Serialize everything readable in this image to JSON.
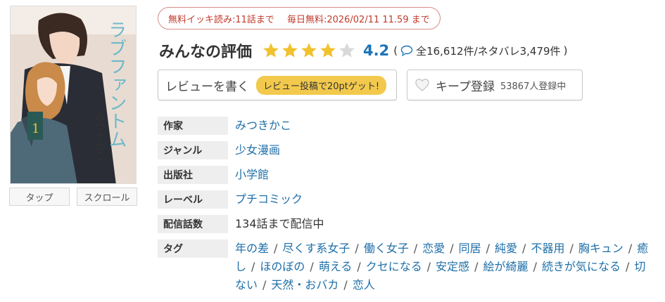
{
  "cover": {
    "title_vertical": "ラブファントム",
    "author_vertical": "みつきかこ",
    "volume": "1"
  },
  "viewer_buttons": [
    {
      "label": "タップ"
    },
    {
      "label": "スクロール"
    }
  ],
  "free_banner": {
    "text1": "無料イッキ読み:11話まで",
    "text2": "毎日無料:2026/02/11 11.59 まで"
  },
  "rating": {
    "title": "みんなの評価",
    "stars_filled": 4,
    "stars_total": 5,
    "score": "4.2",
    "count_text": "全16,612件/ネタバレ3,479件",
    "open_paren": "(",
    "close_paren": ")",
    "colors": {
      "star_filled": "#f2c12e",
      "star_empty": "#d9d9d9",
      "score": "#1a73b8"
    }
  },
  "review_button": {
    "label": "レビューを書く",
    "badge": "レビュー投稿で20ptゲット!"
  },
  "keep_button": {
    "label": "キープ登録",
    "count": "53867人登録中"
  },
  "info": {
    "author": {
      "label": "作家",
      "value": "みつきかこ"
    },
    "genre": {
      "label": "ジャンル",
      "value": "少女漫画"
    },
    "publisher": {
      "label": "出版社",
      "value": "小学館"
    },
    "label_row": {
      "label": "レーベル",
      "value": "プチコミック"
    },
    "episodes": {
      "label": "配信話数",
      "value": "134話まで配信中"
    },
    "tags": {
      "label": "タグ",
      "items": [
        "年の差",
        "尽くす系女子",
        "働く女子",
        "恋愛",
        "同居",
        "純愛",
        "不器用",
        "胸キュン",
        "癒し",
        "ほのぼの",
        "萌える",
        "クセになる",
        "安定感",
        "絵が綺麗",
        "続きが気になる",
        "切ない",
        "天然・おバカ",
        "恋人"
      ],
      "separator": "/"
    }
  }
}
